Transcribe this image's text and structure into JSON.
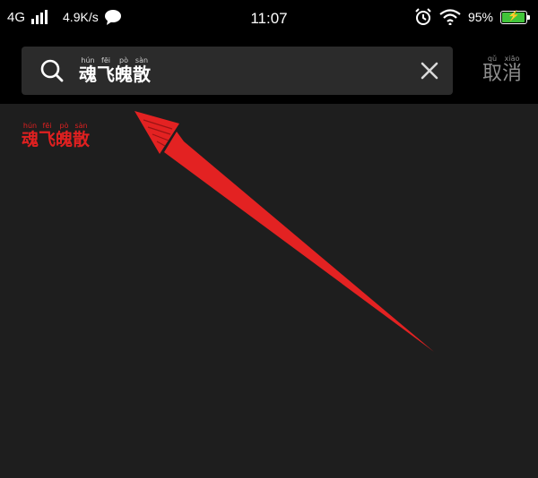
{
  "status_bar": {
    "network": "4G",
    "speed": "4.9K/s",
    "time": "11:07",
    "battery_percent": "95%",
    "battery_level": 0.95
  },
  "search": {
    "query": "魂飞魄散",
    "query_pinyin": [
      "hún",
      "fēi",
      "pò",
      "sàn"
    ],
    "cancel_chars": [
      "取",
      "消"
    ],
    "cancel_pinyin": [
      "qǔ",
      "xiāo"
    ]
  },
  "annotation": {
    "chars": [
      "魂",
      "飞",
      "魄",
      "散"
    ],
    "pinyin": [
      "hún",
      "fēi",
      "pò",
      "sàn"
    ],
    "color": "#e02020"
  },
  "colors": {
    "header_bg": "#000000",
    "page_bg": "#1e1e1e",
    "search_box_bg": "#2b2b2b",
    "battery_green": "#41c43a",
    "annotation_red": "#e02020"
  }
}
